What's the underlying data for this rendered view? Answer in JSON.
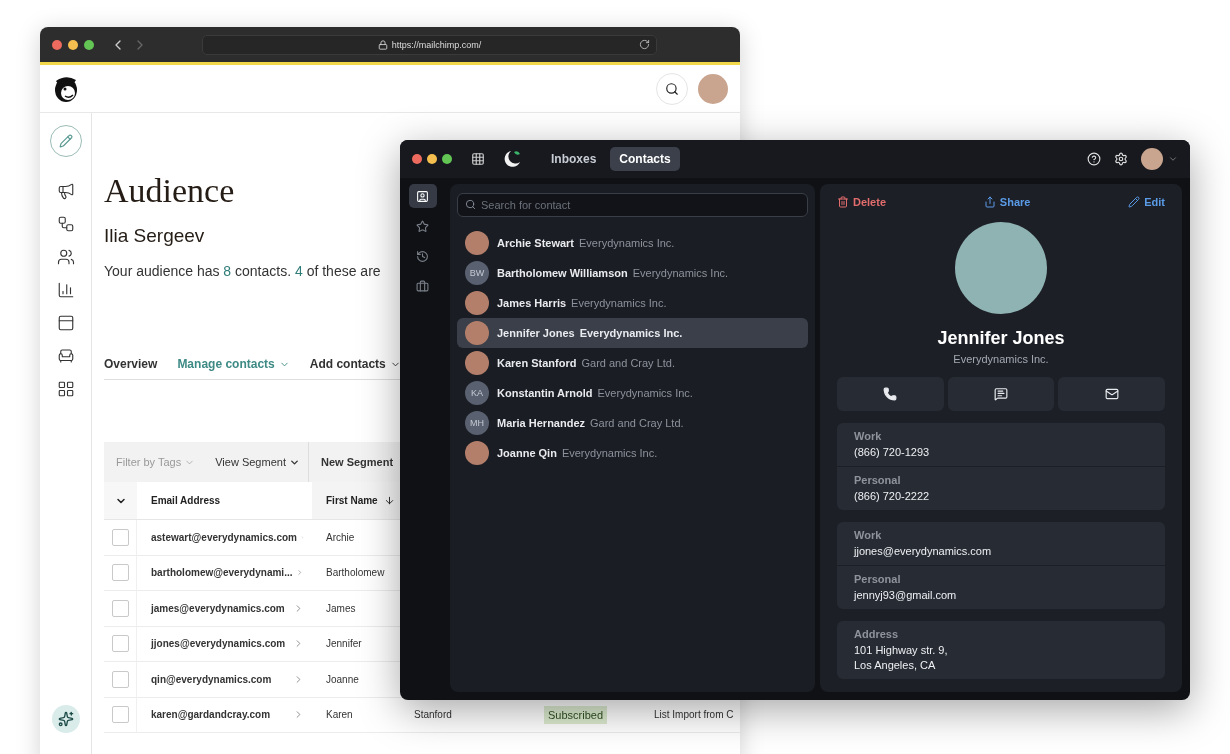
{
  "browser": {
    "url": "https://mailchimp.com/"
  },
  "mailchimp": {
    "title": "Audience",
    "account": "Ilia Sergeev",
    "summary": [
      {
        "text": "Your audience has ",
        "highlight": false
      },
      {
        "text": "8",
        "highlight": true
      },
      {
        "text": " contacts. ",
        "highlight": false
      },
      {
        "text": "4",
        "highlight": true
      },
      {
        "text": " of these are",
        "highlight": false
      }
    ],
    "tabs": [
      {
        "label": "Overview",
        "selected": false,
        "dropdown": false
      },
      {
        "label": "Manage contacts",
        "selected": true,
        "dropdown": true
      },
      {
        "label": "Add contacts",
        "selected": false,
        "dropdown": true
      }
    ],
    "table_toolbar": [
      {
        "label": "Filter by Tags",
        "kind": "muted"
      },
      {
        "label": "View Segment",
        "kind": "dropdown"
      },
      {
        "label": "New Segment",
        "kind": "button"
      }
    ],
    "table": {
      "columns": [
        {
          "label": "Email Address",
          "sorted": false
        },
        {
          "label": "First Name",
          "sorted": true
        }
      ],
      "rows": [
        {
          "checked": false,
          "cells": [
            "astewart@everydynamics.com",
            "Archie"
          ]
        },
        {
          "checked": false,
          "cells": [
            "bartholomew@everydynami...",
            "Bartholomew"
          ]
        },
        {
          "checked": false,
          "cells": [
            "james@everydynamics.com",
            "James"
          ]
        },
        {
          "checked": false,
          "cells": [
            "jjones@everydynamics.com",
            "Jennifer"
          ]
        },
        {
          "checked": false,
          "cells": [
            "qin@everydynamics.com",
            "Joanne"
          ]
        },
        {
          "checked": false,
          "cells": [
            "karen@gardandcray.com",
            "Karen",
            "Stanford",
            "Subscribed",
            "List Import from C"
          ]
        }
      ]
    }
  },
  "app": {
    "tabs": [
      {
        "label": "Inboxes",
        "selected": false
      },
      {
        "label": "Contacts",
        "selected": true
      }
    ],
    "rail": [
      {
        "kind": "contacts",
        "selected": true
      },
      {
        "kind": "starred",
        "selected": false
      },
      {
        "kind": "history",
        "selected": false
      },
      {
        "kind": "work",
        "selected": false
      }
    ],
    "search": {
      "placeholder": "Search for contact"
    },
    "contacts": [
      {
        "name": "Archie Stewart",
        "company": "Everydynamics Inc.",
        "avatar": {
          "kind": "photo"
        },
        "selected": false
      },
      {
        "name": "Bartholomew Williamson",
        "company": "Everydynamics Inc.",
        "avatar": {
          "kind": "initials",
          "initials": "BW"
        },
        "selected": false
      },
      {
        "name": "James Harris",
        "company": "Everydynamics Inc.",
        "avatar": {
          "kind": "photo"
        },
        "selected": false
      },
      {
        "name": "Jennifer Jones",
        "company": "Everydynamics Inc.",
        "avatar": {
          "kind": "photo"
        },
        "selected": true
      },
      {
        "name": "Karen Stanford",
        "company": "Gard and Cray Ltd.",
        "avatar": {
          "kind": "photo"
        },
        "selected": false
      },
      {
        "name": "Konstantin Arnold",
        "company": "Everydynamics Inc.",
        "avatar": {
          "kind": "initials",
          "initials": "KA"
        },
        "selected": false
      },
      {
        "name": "Maria Hernandez",
        "company": "Gard and Cray Ltd.",
        "avatar": {
          "kind": "initials",
          "initials": "MH"
        },
        "selected": false
      },
      {
        "name": "Joanne Qin",
        "company": "Everydynamics Inc.",
        "avatar": {
          "kind": "photo"
        },
        "selected": false
      }
    ],
    "detail": {
      "actions": [
        {
          "label": "Delete",
          "kind": "delete"
        },
        {
          "label": "Share",
          "kind": "share"
        },
        {
          "label": "Edit",
          "kind": "edit"
        }
      ],
      "name": "Jennifer Jones",
      "company": "Everydynamics Inc.",
      "quick_actions": [
        {
          "kind": "call"
        },
        {
          "kind": "sms"
        },
        {
          "kind": "email"
        }
      ],
      "cards": [
        {
          "fields": [
            {
              "label": "Work",
              "value": "(866) 720-1293"
            },
            {
              "label": "Personal",
              "value": "(866) 720-2222"
            }
          ]
        },
        {
          "fields": [
            {
              "label": "Work",
              "value": "jjones@everydynamics.com"
            },
            {
              "label": "Personal",
              "value": "jennyj93@gmail.com"
            }
          ]
        },
        {
          "fields": [
            {
              "label": "Address",
              "value": "101 Highway str. 9,\nLos Angeles, CA"
            }
          ]
        }
      ]
    }
  }
}
